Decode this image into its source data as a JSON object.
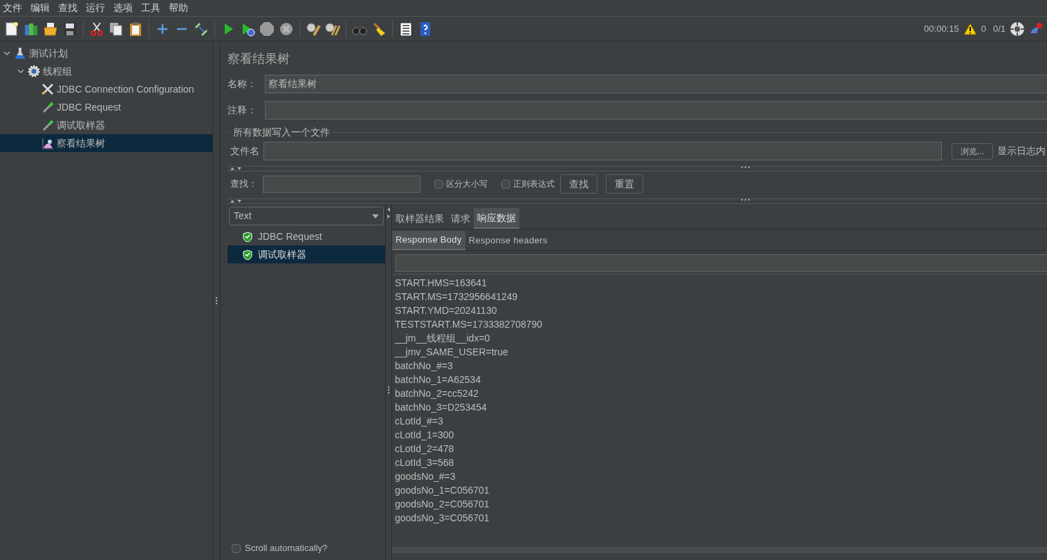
{
  "menu": [
    "文件",
    "编辑",
    "查找",
    "运行",
    "选项",
    "工具",
    "帮助"
  ],
  "status": {
    "elapsed": "00:00:15",
    "warnings": "0",
    "threads": "0/1"
  },
  "tree": [
    {
      "label": "测试计划",
      "kind": "plan",
      "expanded": true,
      "selected": false,
      "children": [
        {
          "label": "线程组",
          "kind": "thread_group",
          "expanded": true,
          "selected": false,
          "children": [
            {
              "label": "JDBC Connection Configuration",
              "kind": "config",
              "selected": false
            },
            {
              "label": "JDBC Request",
              "kind": "sampler",
              "selected": false
            },
            {
              "label": "调试取样器",
              "kind": "sampler",
              "selected": false
            },
            {
              "label": "察看结果树",
              "kind": "listener",
              "selected": true
            }
          ]
        }
      ]
    }
  ],
  "panel": {
    "title": "察看结果树",
    "name_label": "名称：",
    "name_value": "察看结果树",
    "comment_label": "注释：",
    "file_section": "所有数据写入一个文件",
    "file_label": "文件名",
    "browse": "浏览...",
    "log_label": "显示日志内"
  },
  "search": {
    "label": "查找：",
    "options": [
      {
        "label": "区分大小写",
        "checked": false
      },
      {
        "label": "正则表达式",
        "checked": false
      }
    ],
    "find_button": "查找",
    "reset_button": "重置"
  },
  "results": {
    "renderer": "Text",
    "samples": [
      {
        "label": "JDBC Request",
        "success": true,
        "selected": false
      },
      {
        "label": "调试取样器",
        "success": true,
        "selected": true
      }
    ],
    "scroll": {
      "label": "Scroll automatically?",
      "checked": false
    }
  },
  "tabs": [
    {
      "label": "取样器结果",
      "selected": false
    },
    {
      "label": "请求",
      "selected": false
    },
    {
      "label": "响应数据",
      "selected": true
    }
  ],
  "subtabs": [
    {
      "label": "Response Body",
      "selected": true
    },
    {
      "label": "Response headers",
      "selected": false
    }
  ],
  "response_lines": [
    "START.HMS=163641",
    "START.MS=1732956641249",
    "START.YMD=20241130",
    "TESTSTART.MS=1733382708790",
    "__jm__线程组__idx=0",
    "__jmv_SAME_USER=true",
    "batchNo_#=3",
    "batchNo_1=A62534",
    "batchNo_2=cc5242",
    "batchNo_3=D253454",
    "cLotId_#=3",
    "cLotId_1=300",
    "cLotId_2=478",
    "cLotId_3=568",
    "goodsNo_#=3",
    "goodsNo_1=C056701",
    "goodsNo_2=C056701",
    "goodsNo_3=C056701"
  ]
}
